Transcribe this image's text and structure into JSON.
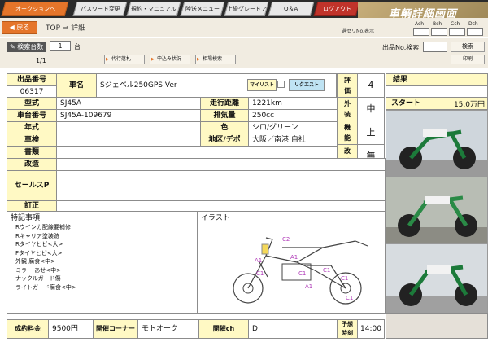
{
  "nav": {
    "auction": "オークションへ",
    "password": "パスワード変更",
    "rules": "規約・マニュアル",
    "shipping": "陸送メニュー",
    "upgrade": "上級グレードアップ",
    "qa": "Q＆A",
    "logout": "ログアウト"
  },
  "banner": "車輌詳細画面",
  "back": "戻る",
  "breadcrumb": "TOP ⇒ 詳細",
  "select_hint": "選セリNo.表示",
  "check_labels": [
    "Ach",
    "Bch",
    "Cch",
    "Dch"
  ],
  "count_label": "検索台数",
  "count_value": "1",
  "count_unit": "台",
  "page": "1/1",
  "action_buttons": [
    "代行落札",
    "申込み状況",
    "相場検索"
  ],
  "search_label": "出品No.検索",
  "search_button": "検索",
  "print_button": "印刷",
  "lot": {
    "label": "出品番号",
    "value": "06317"
  },
  "vehicle": {
    "label": "車名",
    "value": "Sジェベル250GPS Ver"
  },
  "mylist": "マイリスト",
  "request": "リクエスト",
  "model": {
    "label": "型式",
    "value": "SJ45A"
  },
  "mileage": {
    "label": "走行距離",
    "value": "1221km"
  },
  "frame": {
    "label": "車台番号",
    "value": "SJ45A-109679"
  },
  "cc": {
    "label": "排気量",
    "value": "250cc"
  },
  "year": {
    "label": "年式",
    "value": ""
  },
  "color": {
    "label": "色",
    "value": "シロ/グリーン"
  },
  "inspection": {
    "label": "車検",
    "value": ""
  },
  "region": {
    "label": "地区/デポ",
    "value": "大阪／南港 自社"
  },
  "documents": {
    "label": "書類",
    "value": ""
  },
  "modified": {
    "label": "改造",
    "value": ""
  },
  "sales": {
    "label": "セールスP"
  },
  "correction": {
    "label": "訂正"
  },
  "score": {
    "label": "評価",
    "value": "4"
  },
  "exterior": {
    "label": "外装",
    "value": "中"
  },
  "function": {
    "label": "機能",
    "value": "上"
  },
  "modification": {
    "label": "改造",
    "value": "無"
  },
  "result": {
    "label": "結果",
    "value": ""
  },
  "start": {
    "label": "スタート",
    "value": "15.0万円"
  },
  "notes": {
    "label": "特記事項",
    "items": [
      "Rウインカ配線要補修",
      "Rキャリア塗装跡",
      "Rタイヤヒビ<大>",
      "Fタイヤヒビ<大>",
      "外観 腐食<中>",
      "ミラー あせ<中>",
      "ナックルガード傷",
      "ライトガード腐食<中>"
    ]
  },
  "illust": {
    "label": "イラスト",
    "marks": [
      "C2",
      "A1",
      "C1",
      "C1",
      "C1",
      "A1",
      "C1",
      "C1",
      "A1"
    ]
  },
  "fee": {
    "label": "成約料金",
    "value": "9500円"
  },
  "corner": {
    "label": "開催コーナー",
    "value": "モトオーク"
  },
  "ch": {
    "label": "開催ch",
    "value": "D"
  },
  "time": {
    "label": "予想時刻",
    "value": "14:00"
  },
  "colors": {
    "accent": "#e5752a",
    "label_bg": "#fff9c4",
    "grid": "#8c8c8c"
  }
}
